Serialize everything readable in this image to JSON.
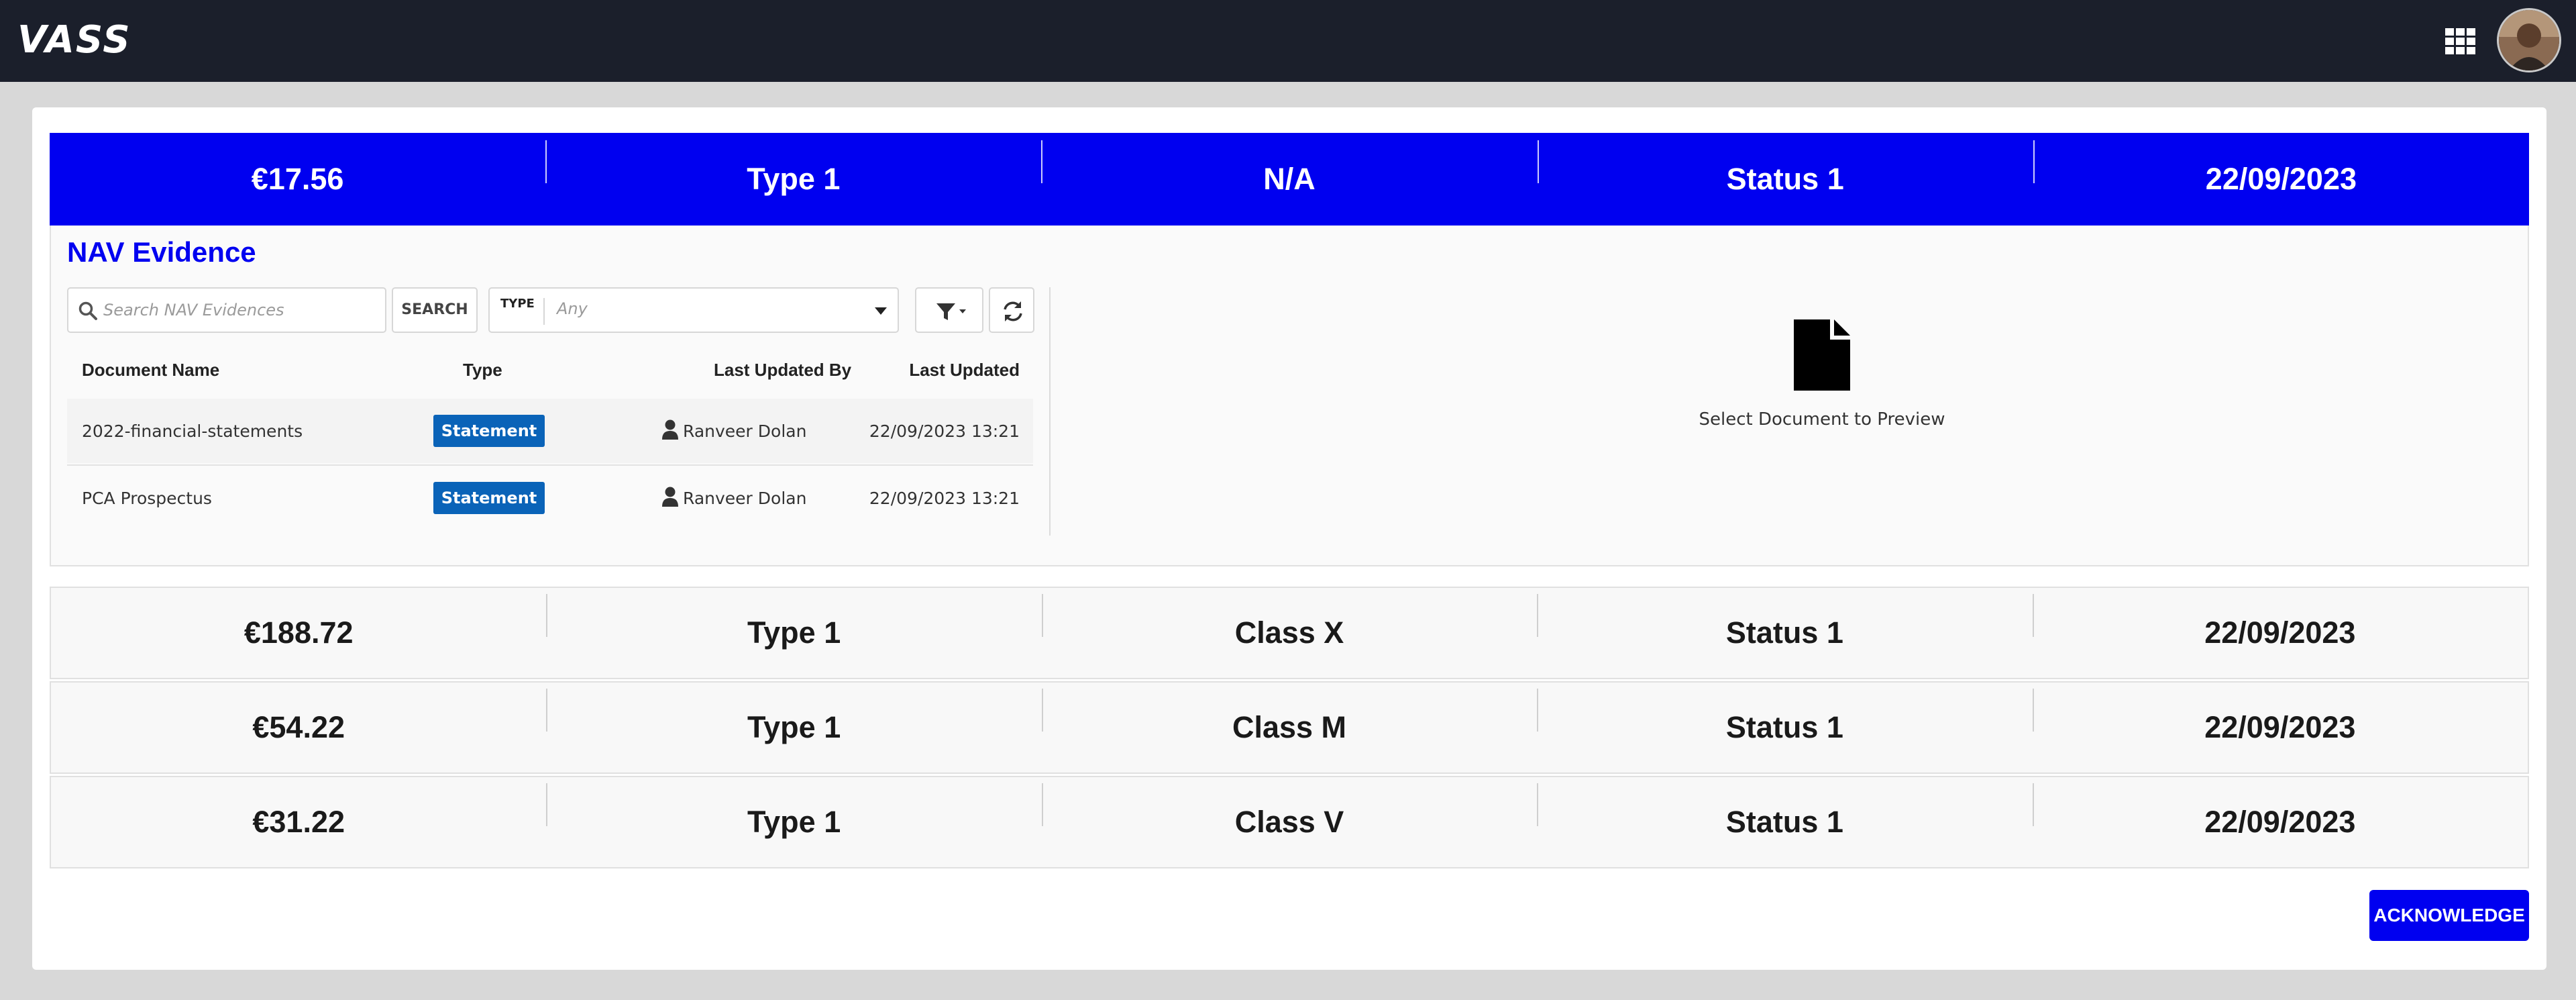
{
  "app": {
    "logo_text": "VASS",
    "icons": {
      "apps": "grid-apps-icon",
      "avatar": "user-avatar"
    }
  },
  "summary": {
    "amount": "€17.56",
    "type": "Type 1",
    "class": "N/A",
    "status": "Status 1",
    "date": "22/09/2023"
  },
  "evidence": {
    "title": "NAV Evidence",
    "search_placeholder": "Search NAV Evidences",
    "search_button": "SEARCH",
    "type_filter": {
      "label": "TYPE",
      "value": "Any"
    },
    "columns": [
      "Document Name",
      "Type",
      "Last Updated By",
      "Last Updated"
    ],
    "rows": [
      {
        "name": "2022-financial-statements",
        "type": "Statement",
        "updated_by": "Ranveer Dolan",
        "updated": "22/09/2023 13:21"
      },
      {
        "name": "PCA Prospectus",
        "type": "Statement",
        "updated_by": "Ranveer Dolan",
        "updated": "22/09/2023 13:21"
      }
    ],
    "preview_text": "Select Document to Preview",
    "colors": {
      "title": "#0000f0",
      "badge": "#0a63b8"
    }
  },
  "classes": [
    {
      "amount": "€188.72",
      "type": "Type 1",
      "class": "Class X",
      "status": "Status 1",
      "date": "22/09/2023"
    },
    {
      "amount": "€54.22",
      "type": "Type 1",
      "class": "Class M",
      "status": "Status 1",
      "date": "22/09/2023"
    },
    {
      "amount": "€31.22",
      "type": "Type 1",
      "class": "Class V",
      "status": "Status 1",
      "date": "22/09/2023"
    }
  ],
  "actions": {
    "acknowledge": "ACKNOWLEDGE"
  },
  "colors": {
    "topbar": "#1b1f2b",
    "accent": "#0000f0",
    "background": "#d8d8d8"
  }
}
